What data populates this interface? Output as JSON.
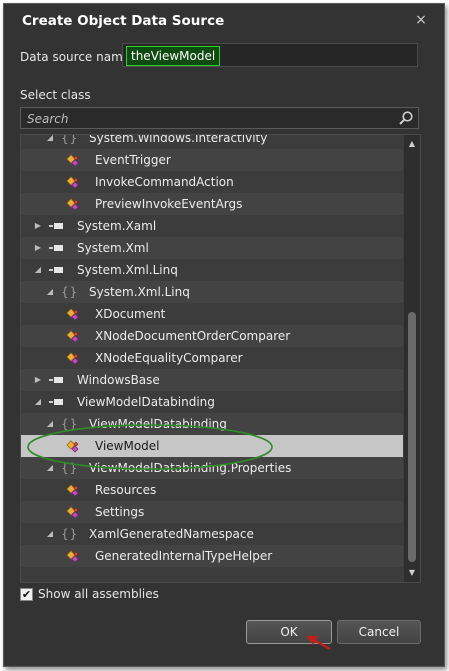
{
  "dialog": {
    "title": "Create Object Data Source",
    "close_glyph": "×"
  },
  "data_source": {
    "label": "Data source name",
    "value": "theViewModel"
  },
  "select_class": {
    "label": "Select class",
    "search_placeholder": "Search"
  },
  "tree": {
    "rows": [
      {
        "kind": "namespace",
        "level": 1,
        "expanded": true,
        "label": "System.Windows.Interactivity"
      },
      {
        "kind": "class",
        "level": 2,
        "label": "EventTrigger"
      },
      {
        "kind": "class",
        "level": 2,
        "label": "InvokeCommandAction"
      },
      {
        "kind": "class",
        "level": 2,
        "label": "PreviewInvokeEventArgs"
      },
      {
        "kind": "assembly",
        "level": 0,
        "expanded": false,
        "label": "System.Xaml"
      },
      {
        "kind": "assembly",
        "level": 0,
        "expanded": false,
        "label": "System.Xml"
      },
      {
        "kind": "assembly",
        "level": 0,
        "expanded": true,
        "label": "System.Xml.Linq"
      },
      {
        "kind": "namespace",
        "level": 1,
        "expanded": true,
        "label": "System.Xml.Linq"
      },
      {
        "kind": "class",
        "level": 2,
        "label": "XDocument"
      },
      {
        "kind": "class",
        "level": 2,
        "label": "XNodeDocumentOrderComparer"
      },
      {
        "kind": "class",
        "level": 2,
        "label": "XNodeEqualityComparer"
      },
      {
        "kind": "assembly",
        "level": 0,
        "expanded": false,
        "label": "WindowsBase"
      },
      {
        "kind": "assembly",
        "level": 0,
        "expanded": true,
        "label": "ViewModelDatabinding"
      },
      {
        "kind": "namespace",
        "level": 1,
        "expanded": true,
        "label": "ViewModelDatabinding"
      },
      {
        "kind": "class",
        "level": 2,
        "label": "ViewModel",
        "selected": true
      },
      {
        "kind": "namespace",
        "level": 1,
        "expanded": true,
        "label": "ViewModelDatabinding.Properties"
      },
      {
        "kind": "class",
        "level": 2,
        "label": "Resources"
      },
      {
        "kind": "class",
        "level": 2,
        "label": "Settings"
      },
      {
        "kind": "namespace",
        "level": 1,
        "expanded": true,
        "label": "XamlGeneratedNamespace"
      },
      {
        "kind": "class",
        "level": 2,
        "label": "GeneratedInternalTypeHelper"
      }
    ]
  },
  "options": {
    "show_all_assemblies_label": "Show all assemblies",
    "show_all_assemblies_checked": true
  },
  "buttons": {
    "ok": "OK",
    "cancel": "Cancel"
  },
  "icons": {
    "namespace_glyph": "{}",
    "check_glyph": "✔",
    "scroll_up_glyph": "▲",
    "scroll_down_glyph": "▼",
    "expanded_glyph": "◢",
    "collapsed_glyph": "▶"
  },
  "colors": {
    "dialog_bg": "#333333",
    "highlight_green": "#2ed02e",
    "annotation_green": "#2f8a2a",
    "annotation_red": "#c0201a",
    "selected_row": "#c6c6c6"
  }
}
